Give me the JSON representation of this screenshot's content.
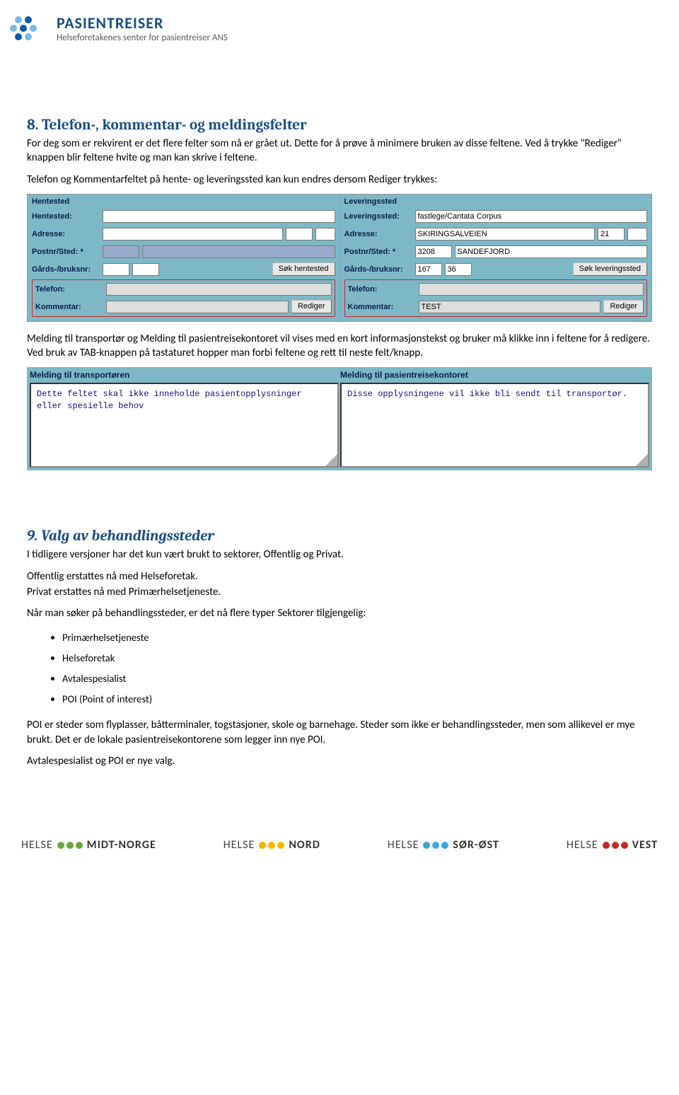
{
  "header": {
    "brand_title": "PASIENTREISER",
    "brand_sub": "Helseforetakenes senter for pasientreiser ANS",
    "logo_dots": [
      "#79b6e8",
      "#0e59a7",
      "#79b6e8",
      "#0e59a7",
      "#79b6e8",
      "#0e59a7",
      "#79b6e8"
    ]
  },
  "section8": {
    "title": "8. Telefon-, kommentar- og meldingsfelter",
    "para1": "For deg som er rekvirent er det flere felter som nå er grået ut. Dette for å prøve å minimere bruken av disse feltene. Ved å trykke \"Rediger\" knappen blir feltene hvite og man kan skrive i feltene.",
    "para2": "Telefon og Kommentarfeltet på hente- og leveringssted kan kun endres dersom Rediger trykkes:",
    "para3": "Melding til transportør og Melding til pasientreisekontoret vil vises med en kort informasjonstekst og bruker må klikke inn i feltene for å redigere. Ved bruk av TAB-knappen på tastaturet hopper man forbi feltene og rett til neste felt/knapp."
  },
  "form": {
    "hentested": {
      "title": "Hentested",
      "rows": {
        "hentested": "Hentested:",
        "adresse": "Adresse:",
        "postnr": "Postnr/Sted: *",
        "gards": "Gårds-/bruksnr:",
        "telefon": "Telefon:",
        "kommentar": "Kommentar:"
      },
      "btn_sok": "Søk hentested",
      "btn_rediger": "Rediger"
    },
    "leveringssted": {
      "title": "Leveringssted",
      "rows": {
        "leveringssted": "Leveringssted:",
        "adresse": "Adresse:",
        "postnr": "Postnr/Sted: *",
        "gards": "Gårds-/bruksnr:",
        "telefon": "Telefon:",
        "kommentar": "Kommentar:"
      },
      "vals": {
        "leveringssted": "fastlege/Cantata Corpus",
        "adresse": "SKIRINGSALVEIEN",
        "adresse_nr": "21",
        "postnr": "3208",
        "sted": "SANDEFJORD",
        "g1": "167",
        "g2": "36",
        "kommentar": "TEST"
      },
      "btn_sok": "Søk leveringssted",
      "btn_rediger": "Rediger"
    }
  },
  "messages": {
    "left_title": "Melding til transportøren",
    "right_title": "Melding til pasientreisekontoret",
    "left_text": "Dette feltet skal ikke inneholde pasientopplysninger eller spesielle behov",
    "right_text": "Disse opplysningene vil ikke bli sendt til transportør."
  },
  "section9": {
    "title": "9. Valg av behandlingssteder",
    "para1": "I tidligere versjoner har det kun vært brukt to sektorer, Offentlig og Privat.",
    "para2a": "Offentlig erstattes nå med Helseforetak.",
    "para2b": "Privat erstattes nå med Primærhelsetjeneste.",
    "para3": "Når man søker på behandlingssteder, er det nå flere typer Sektorer tilgjengelig:",
    "list": [
      "Primærhelsetjeneste",
      "Helseforetak",
      "Avtalespesialist",
      "POI (Point of interest)"
    ],
    "para4": "POI er steder som flyplasser, båtterminaler, togstasjoner, skole og barnehage. Steder som ikke er behandlingssteder, men som allikevel er mye brukt. Det er de lokale pasientreisekontorene som legger inn nye POI.",
    "para5": "Avtalespesialist og POI er nye valg."
  },
  "footer": {
    "prefix": "HELSE",
    "regions": [
      {
        "name": "MIDT-NORGE",
        "color": "#6ea43a"
      },
      {
        "name": "NORD",
        "color": "#f7b500"
      },
      {
        "name": "SØR-ØST",
        "color": "#3ba6d6"
      },
      {
        "name": "VEST",
        "color": "#c62828"
      }
    ]
  }
}
